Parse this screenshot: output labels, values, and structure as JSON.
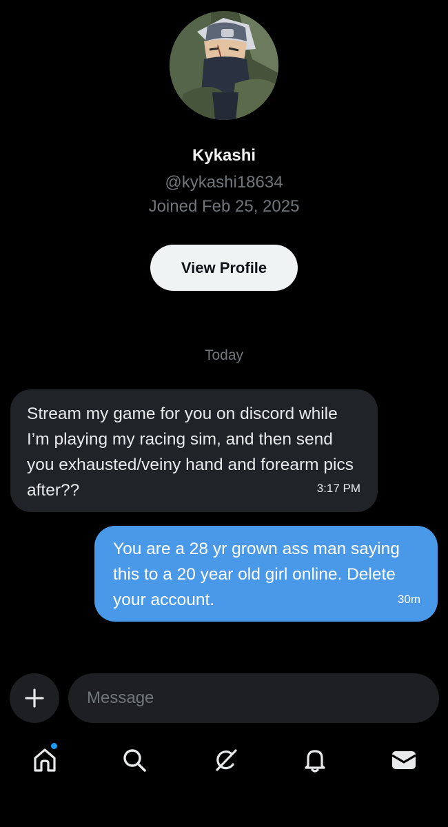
{
  "profile": {
    "display_name": "Kykashi",
    "handle": "@kykashi18634",
    "joined": "Joined Feb 25, 2025",
    "view_profile_label": "View Profile"
  },
  "conversation": {
    "date_separator": "Today",
    "messages": [
      {
        "direction": "received",
        "text": "Stream my game for you on discord while I’m playing my racing sim, and then send you exhausted/veiny hand and forearm pics after??",
        "time": "3:17 PM"
      },
      {
        "direction": "sent",
        "text": "You are a 28 yr grown ass man saying this to a 20 year old girl online. Delete your account.",
        "time": "30m"
      }
    ]
  },
  "composer": {
    "placeholder": "Message",
    "add_icon": "plus-icon"
  },
  "bottom_nav": {
    "items": [
      {
        "icon": "home-icon",
        "has_notification_dot": true
      },
      {
        "icon": "search-icon"
      },
      {
        "icon": "grok-icon"
      },
      {
        "icon": "bell-icon"
      },
      {
        "icon": "mail-icon",
        "active": true
      }
    ]
  },
  "colors": {
    "background": "#000000",
    "received_bubble": "#202327",
    "sent_bubble": "#4a99e9",
    "muted_text": "#71767b",
    "accent_dot": "#1d9bf0"
  }
}
